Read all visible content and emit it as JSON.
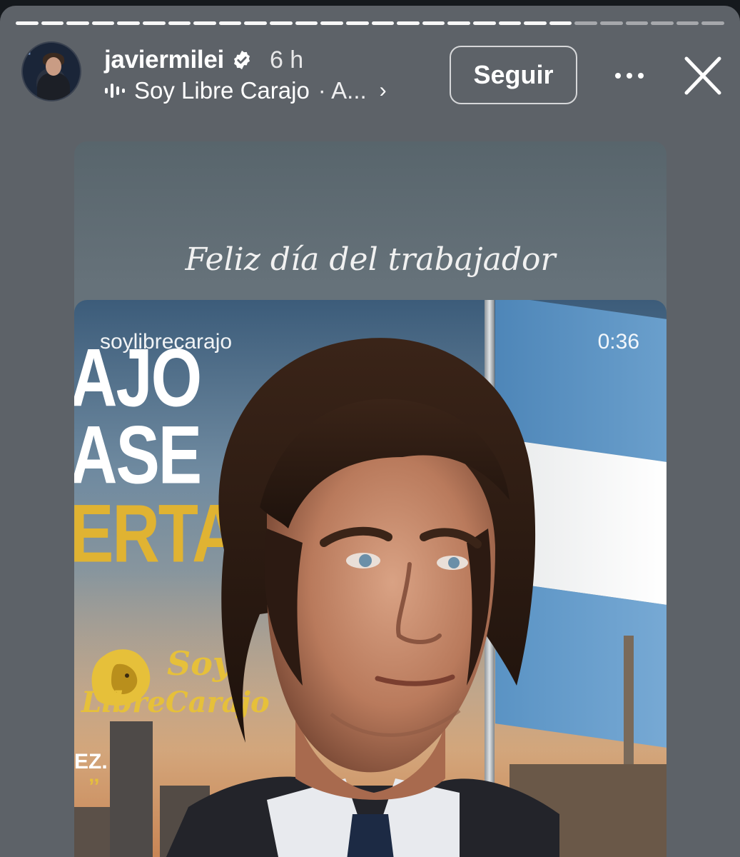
{
  "story": {
    "progress_segments": [
      {
        "state": "done"
      },
      {
        "state": "done"
      },
      {
        "state": "done"
      },
      {
        "state": "done"
      },
      {
        "state": "done"
      },
      {
        "state": "done"
      },
      {
        "state": "done"
      },
      {
        "state": "done"
      },
      {
        "state": "done"
      },
      {
        "state": "done"
      },
      {
        "state": "done"
      },
      {
        "state": "done"
      },
      {
        "state": "done"
      },
      {
        "state": "done"
      },
      {
        "state": "done"
      },
      {
        "state": "done"
      },
      {
        "state": "done"
      },
      {
        "state": "done"
      },
      {
        "state": "done"
      },
      {
        "state": "done"
      },
      {
        "state": "done"
      },
      {
        "state": "done"
      },
      {
        "state": "pending"
      },
      {
        "state": "pending"
      },
      {
        "state": "pending"
      },
      {
        "state": "pending"
      },
      {
        "state": "pending"
      },
      {
        "state": "pending"
      }
    ]
  },
  "header": {
    "username": "javiermilei",
    "time_ago": "6 h",
    "audio_title": "Soy Libre Carajo",
    "audio_artist": "· A...",
    "follow_label": "Seguir",
    "more_icon": "more-horizontal-icon",
    "close_icon": "close-icon",
    "verified_icon": "verified-badge-icon"
  },
  "card": {
    "caption": "Feliz día del trabajador",
    "reel_username": "soylibrecarajo",
    "reel_duration": "0:36",
    "poster_lines": [
      "AJO",
      "ASE",
      "ERTAD"
    ],
    "logo_soy": "Soy",
    "logo_name": "LibreCarajo",
    "ez_text": "EZ.",
    "quote_marks": "’’"
  },
  "colors": {
    "story_bg": "#5d6268",
    "accent_gold": "#e0b332",
    "flag_blue": "#5a93c4"
  }
}
